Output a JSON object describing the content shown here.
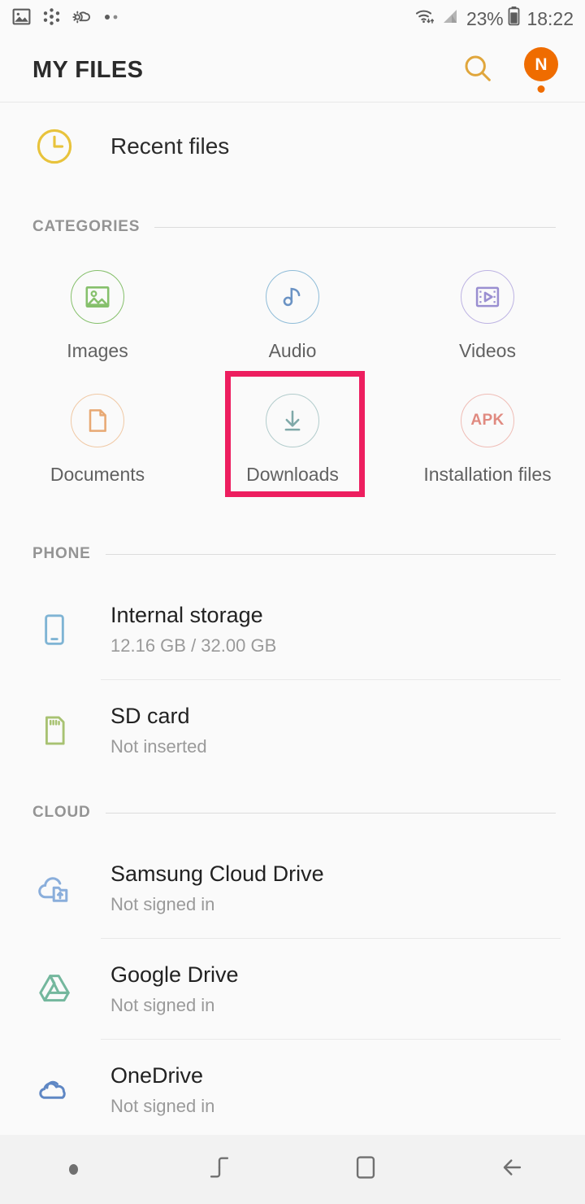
{
  "statusbar": {
    "left_icons": [
      {
        "name": "image-icon",
        "label": "image"
      },
      {
        "name": "bluetooth-share-icon",
        "label": "share"
      },
      {
        "name": "weather-icon",
        "label": "weather"
      },
      {
        "name": "more-notifications-icon",
        "label": "more"
      }
    ],
    "wifi": "wifi-icon",
    "signal": "cellular-signal-icon",
    "battery_percent": "23%",
    "battery_icon": "battery-icon",
    "time": "18:22"
  },
  "appbar": {
    "title": "MY FILES",
    "search_icon": "search-icon",
    "avatar_initial": "N",
    "accent_color": "#ef6c00",
    "search_color": "#e0a63c"
  },
  "recent": {
    "label": "Recent files",
    "icon": "clock-icon",
    "color": "#e8c33c"
  },
  "sections": {
    "categories_title": "CATEGORIES",
    "phone_title": "PHONE",
    "cloud_title": "CLOUD"
  },
  "categories": [
    {
      "label": "Images",
      "icon": "image-icon",
      "color": "#86c06c"
    },
    {
      "label": "Audio",
      "icon": "music-note-icon",
      "color": "#6b93c4"
    },
    {
      "label": "Videos",
      "icon": "video-film-icon",
      "color": "#9a8fd1"
    },
    {
      "label": "Documents",
      "icon": "document-icon",
      "color": "#e8a974"
    },
    {
      "label": "Downloads",
      "icon": "download-icon",
      "color": "#7fa8a8"
    },
    {
      "label": "Installation files",
      "icon": "apk-icon",
      "color": "#e08a80",
      "icon_text": "APK"
    }
  ],
  "highlight": {
    "target": "Downloads",
    "color": "#ed1e5f"
  },
  "phone_storage": [
    {
      "title": "Internal storage",
      "subtitle": "12.16 GB / 32.00 GB",
      "icon": "phone-icon",
      "color": "#7fb4d4"
    },
    {
      "title": "SD card",
      "subtitle": "Not inserted",
      "icon": "sd-card-icon",
      "color": "#a8c272"
    }
  ],
  "cloud_services": [
    {
      "title": "Samsung Cloud Drive",
      "subtitle": "Not signed in",
      "icon": "samsung-cloud-icon",
      "color": "#8aaedb"
    },
    {
      "title": "Google Drive",
      "subtitle": "Not signed in",
      "icon": "google-drive-icon",
      "color": "#74b79d"
    },
    {
      "title": "OneDrive",
      "subtitle": "Not signed in",
      "icon": "onedrive-icon",
      "color": "#5f87c4"
    }
  ],
  "navbar": {
    "items": [
      {
        "name": "nav-dot",
        "label": "dot-indicator"
      },
      {
        "name": "nav-recents",
        "label": "recents-icon"
      },
      {
        "name": "nav-home",
        "label": "home-icon"
      },
      {
        "name": "nav-back",
        "label": "back-arrow-icon"
      }
    ]
  }
}
